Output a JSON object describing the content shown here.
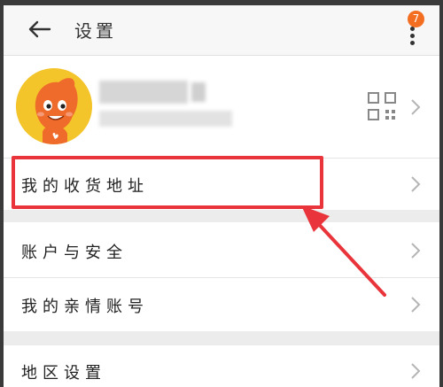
{
  "header": {
    "title": "设置",
    "badge_count": "7"
  },
  "menu": {
    "address": "我的收货地址",
    "account_security": "账户与安全",
    "family_account": "我的亲情账号",
    "region": "地区设置"
  },
  "colors": {
    "accent": "#f36e21",
    "highlight": "#e8343a",
    "avatar_bg": "#f4c52b"
  },
  "icons": [
    "back-arrow-icon",
    "more-vertical-icon",
    "qr-code-icon",
    "chevron-right-icon"
  ]
}
